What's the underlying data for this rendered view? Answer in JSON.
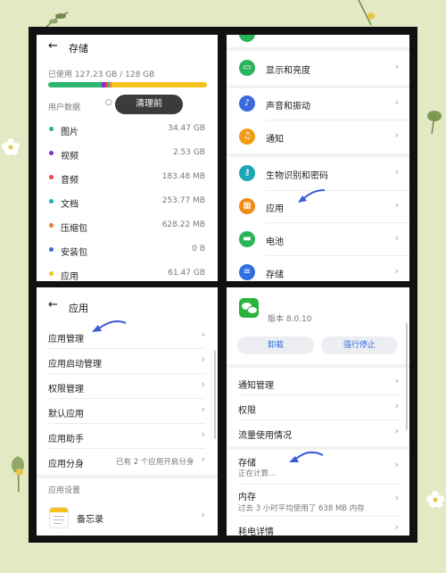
{
  "storage": {
    "title": "存储",
    "used": "已使用 127.23 GB / 128 GB",
    "section": "用户数据",
    "clean_button": "清理前",
    "items": [
      {
        "label": "图片",
        "size": "34.47 GB",
        "color": "#2bb673"
      },
      {
        "label": "视频",
        "size": "2.53 GB",
        "color": "#8e2ac4"
      },
      {
        "label": "音频",
        "size": "183.48 MB",
        "color": "#e8463b"
      },
      {
        "label": "文档",
        "size": "253.77 MB",
        "color": "#1fb4b0"
      },
      {
        "label": "压缩包",
        "size": "628.22 MB",
        "color": "#f07a2a"
      },
      {
        "label": "安装包",
        "size": "0 B",
        "color": "#2f6fe2"
      },
      {
        "label": "应用",
        "size": "61.47 GB",
        "color": "#f5c21b"
      }
    ]
  },
  "settings": {
    "items": [
      {
        "label": "显示和亮度",
        "icon": "display-icon",
        "color": "#2bb45a"
      },
      {
        "label": "声音和振动",
        "icon": "sound-icon",
        "color": "#3b68e0"
      },
      {
        "label": "通知",
        "icon": "bell-icon",
        "color": "#f29b14"
      },
      {
        "label": "生物识别和密码",
        "icon": "key-icon",
        "color": "#1ea6b6"
      },
      {
        "label": "应用",
        "icon": "apps-icon",
        "color": "#f08a14"
      },
      {
        "label": "电池",
        "icon": "battery-icon",
        "color": "#2bb45a"
      },
      {
        "label": "存储",
        "icon": "storage-icon",
        "color": "#2f6fe2"
      }
    ]
  },
  "apps": {
    "title": "应用",
    "items": [
      {
        "label": "应用管理",
        "value": ""
      },
      {
        "label": "应用启动管理",
        "value": ""
      },
      {
        "label": "权限管理",
        "value": ""
      },
      {
        "label": "默认应用",
        "value": ""
      },
      {
        "label": "应用助手",
        "value": ""
      },
      {
        "label": "应用分身",
        "value": "已有 2 个应用开启分身"
      }
    ],
    "section": "应用设置",
    "memo_label": "备忘录"
  },
  "wechat": {
    "version": "版本 8.0.10",
    "uninstall_button": "卸载",
    "force_stop_button": "强行停止",
    "items": [
      {
        "label": "通知管理",
        "sub": ""
      },
      {
        "label": "权限",
        "sub": ""
      },
      {
        "label": "流量使用情况",
        "sub": ""
      },
      {
        "label": "存储",
        "sub": "正在计算..."
      },
      {
        "label": "内存",
        "sub": "过去 3 小时平均使用了 638 MB 内存"
      },
      {
        "label": "耗电详情",
        "sub": ""
      }
    ]
  }
}
